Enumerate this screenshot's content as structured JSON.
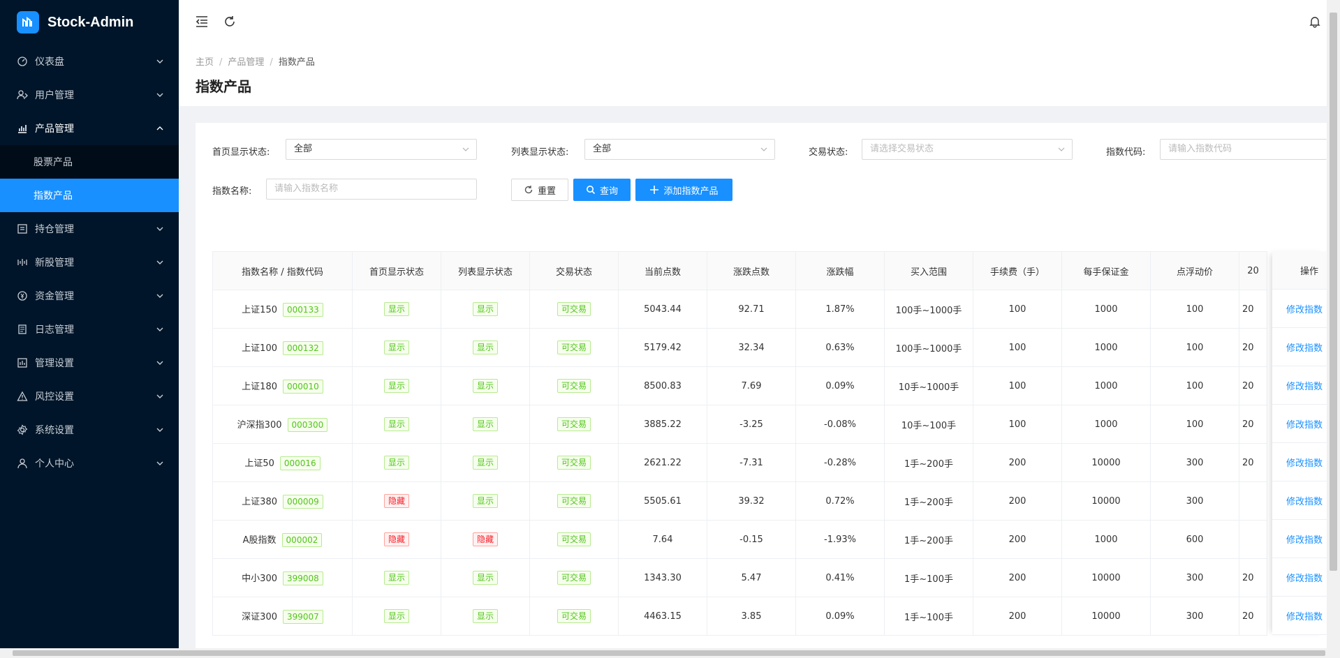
{
  "app": {
    "name": "Stock-Admin"
  },
  "sidebar": {
    "items": [
      {
        "label": "仪表盘",
        "icon": "dashboard-icon",
        "name": "sidebar-item-dashboard"
      },
      {
        "label": "用户管理",
        "icon": "user-manage-icon",
        "name": "sidebar-item-users"
      },
      {
        "label": "产品管理",
        "icon": "bar-chart-icon",
        "name": "sidebar-item-products"
      },
      {
        "label": "持仓管理",
        "icon": "position-icon",
        "name": "sidebar-item-positions"
      },
      {
        "label": "新股管理",
        "icon": "ipo-icon",
        "name": "sidebar-item-ipo"
      },
      {
        "label": "资金管理",
        "icon": "money-icon",
        "name": "sidebar-item-funds"
      },
      {
        "label": "日志管理",
        "icon": "log-icon",
        "name": "sidebar-item-logs"
      },
      {
        "label": "管理设置",
        "icon": "admin-settings-icon",
        "name": "sidebar-item-admin-settings"
      },
      {
        "label": "风控设置",
        "icon": "warning-icon",
        "name": "sidebar-item-risk"
      },
      {
        "label": "系统设置",
        "icon": "gear-icon",
        "name": "sidebar-item-system"
      },
      {
        "label": "个人中心",
        "icon": "person-icon",
        "name": "sidebar-item-profile"
      }
    ],
    "sub_items": [
      {
        "label": "股票产品"
      },
      {
        "label": "指数产品"
      }
    ]
  },
  "breadcrumb": {
    "home": "主页",
    "section": "产品管理",
    "current": "指数产品"
  },
  "page_title": "指数产品",
  "filters": {
    "home_status_label": "首页显示状态:",
    "home_status_value": "全部",
    "list_status_label": "列表显示状态:",
    "list_status_value": "全部",
    "trade_status_label": "交易状态:",
    "trade_status_placeholder": "请选择交易状态",
    "code_label": "指数代码:",
    "code_placeholder": "请输入指数代码",
    "name_label": "指数名称:",
    "name_placeholder": "请输入指数名称"
  },
  "buttons": {
    "reset": "重置",
    "search": "查询",
    "add": "添加指数产品"
  },
  "table": {
    "headers": [
      "指数名称 / 指数代码",
      "首页显示状态",
      "列表显示状态",
      "交易状态",
      "当前点数",
      "涨跌点数",
      "涨跌幅",
      "买入范围",
      "手续费（手）",
      "每手保证金",
      "点浮动价",
      "20"
    ],
    "op_header": "操作",
    "op_label": "修改指数",
    "rows": [
      {
        "name": "上证150",
        "code": "000133",
        "home": "显示",
        "list": "显示",
        "trade": "可交易",
        "price": "5043.44",
        "change": "92.71",
        "pct": "1.87%",
        "range": "100手~1000手",
        "fee": "100",
        "margin": "1000",
        "float": "100",
        "extra": "20",
        "dir": "up",
        "home_hidden": false,
        "list_hidden": false
      },
      {
        "name": "上证100",
        "code": "000132",
        "home": "显示",
        "list": "显示",
        "trade": "可交易",
        "price": "5179.42",
        "change": "32.34",
        "pct": "0.63%",
        "range": "100手~1000手",
        "fee": "100",
        "margin": "1000",
        "float": "100",
        "extra": "20",
        "dir": "up",
        "home_hidden": false,
        "list_hidden": false
      },
      {
        "name": "上证180",
        "code": "000010",
        "home": "显示",
        "list": "显示",
        "trade": "可交易",
        "price": "8500.83",
        "change": "7.69",
        "pct": "0.09%",
        "range": "10手~1000手",
        "fee": "100",
        "margin": "1000",
        "float": "100",
        "extra": "20",
        "dir": "up",
        "home_hidden": false,
        "list_hidden": false
      },
      {
        "name": "沪深指300",
        "code": "000300",
        "home": "显示",
        "list": "显示",
        "trade": "可交易",
        "price": "3885.22",
        "change": "-3.25",
        "pct": "-0.08%",
        "range": "10手~100手",
        "fee": "100",
        "margin": "1000",
        "float": "100",
        "extra": "20",
        "dir": "down",
        "home_hidden": false,
        "list_hidden": false
      },
      {
        "name": "上证50",
        "code": "000016",
        "home": "显示",
        "list": "显示",
        "trade": "可交易",
        "price": "2621.22",
        "change": "-7.31",
        "pct": "-0.28%",
        "range": "1手~200手",
        "fee": "200",
        "margin": "10000",
        "float": "300",
        "extra": "20",
        "dir": "down",
        "home_hidden": false,
        "list_hidden": false
      },
      {
        "name": "上证380",
        "code": "000009",
        "home": "隐藏",
        "list": "显示",
        "trade": "可交易",
        "price": "5505.61",
        "change": "39.32",
        "pct": "0.72%",
        "range": "1手~200手",
        "fee": "200",
        "margin": "10000",
        "float": "300",
        "extra": "",
        "dir": "up",
        "home_hidden": true,
        "list_hidden": false
      },
      {
        "name": "A股指数",
        "code": "000002",
        "home": "隐藏",
        "list": "隐藏",
        "trade": "可交易",
        "price": "7.64",
        "change": "-0.15",
        "pct": "-1.93%",
        "range": "1手~200手",
        "fee": "200",
        "margin": "1000",
        "float": "600",
        "extra": "",
        "dir": "down",
        "home_hidden": true,
        "list_hidden": true
      },
      {
        "name": "中小300",
        "code": "399008",
        "home": "显示",
        "list": "显示",
        "trade": "可交易",
        "price": "1343.30",
        "change": "5.47",
        "pct": "0.41%",
        "range": "1手~100手",
        "fee": "200",
        "margin": "10000",
        "float": "300",
        "extra": "20",
        "dir": "up",
        "home_hidden": false,
        "list_hidden": false
      },
      {
        "name": "深证300",
        "code": "399007",
        "home": "显示",
        "list": "显示",
        "trade": "可交易",
        "price": "4463.15",
        "change": "3.85",
        "pct": "0.09%",
        "range": "1手~100手",
        "fee": "200",
        "margin": "10000",
        "float": "300",
        "extra": "20",
        "dir": "up",
        "home_hidden": false,
        "list_hidden": false
      }
    ]
  },
  "colors": {
    "accent": "#1890ff",
    "sidebar_bg": "#001529",
    "up": "#d63031",
    "down": "#3aa845"
  }
}
